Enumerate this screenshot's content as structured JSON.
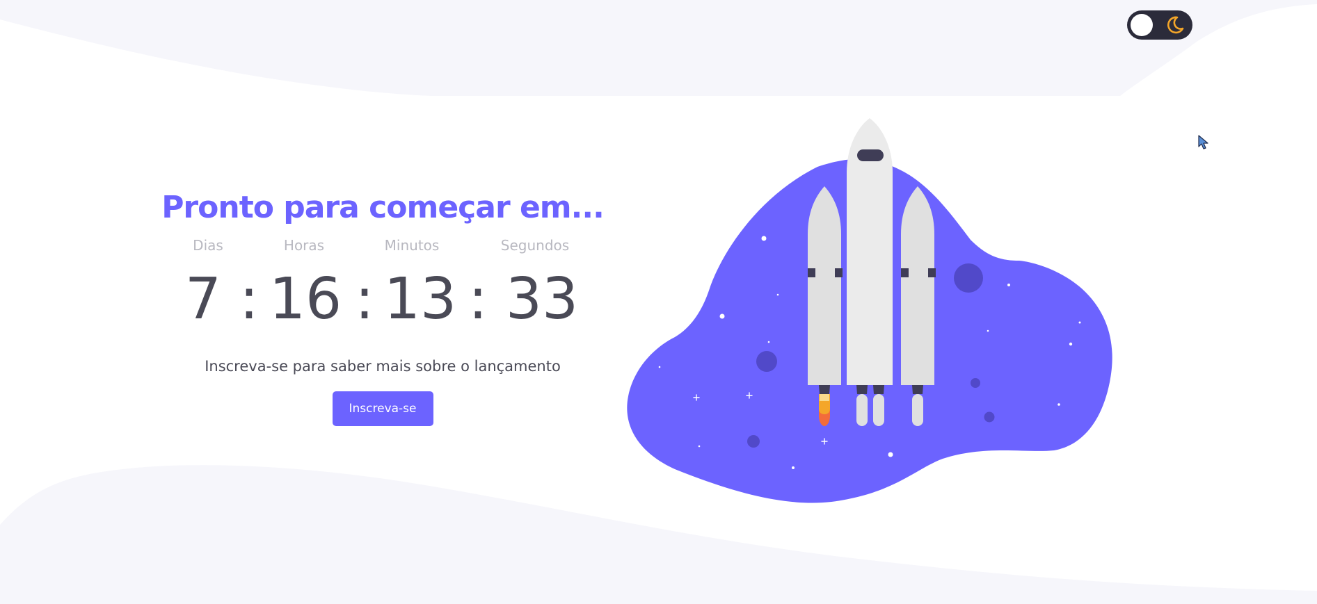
{
  "theme_toggle": {
    "icon": "moon-icon",
    "knob_color": "#ffffff",
    "track_color": "#2b2b3a",
    "moon_color": "#f4a629"
  },
  "hero": {
    "headline": "Pronto para começar em...",
    "labels": {
      "days": "Dias",
      "hours": "Horas",
      "minutes": "Minutos",
      "seconds": "Segundos"
    },
    "countdown": {
      "days": "7",
      "hours": "16",
      "minutes": "13",
      "seconds": "33",
      "separator": ":"
    },
    "subtitle": "Inscreva-se para saber mais sobre o lançamento",
    "button_label": "Inscreva-se"
  },
  "colors": {
    "accent": "#6c63ff",
    "text_dark": "#4a4a56",
    "text_muted": "#b8b8c0",
    "background_wave": "#f6f6fb"
  },
  "illustration": {
    "icon": "rocket-launch-illustration"
  }
}
